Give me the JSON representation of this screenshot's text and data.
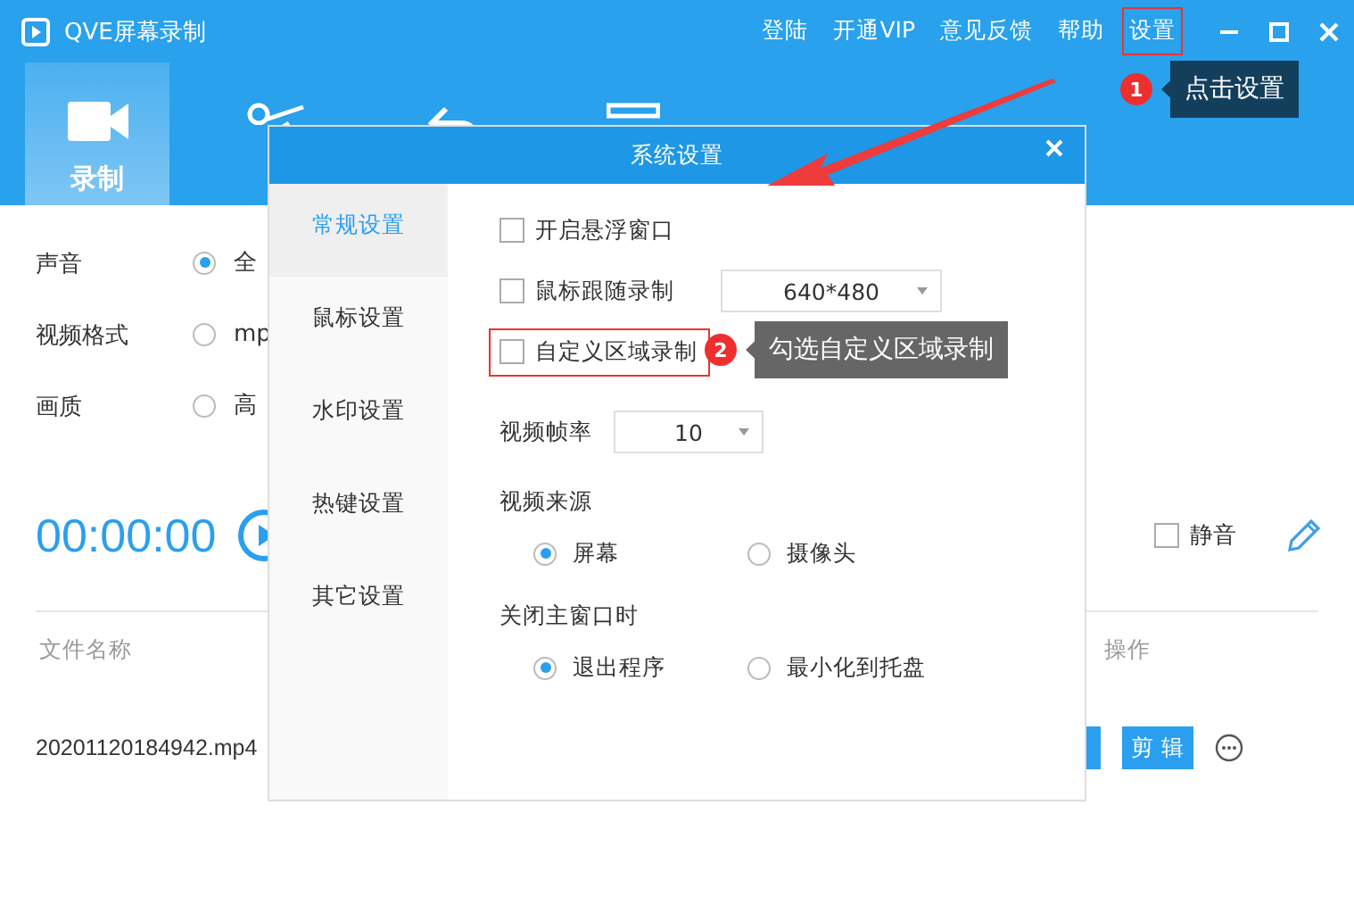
{
  "window": {
    "title": "QVE屏幕录制"
  },
  "top_menu": [
    {
      "label": "登陆",
      "highlighted": false
    },
    {
      "label": "开通VIP",
      "highlighted": false
    },
    {
      "label": "意见反馈",
      "highlighted": false
    },
    {
      "label": "帮助",
      "highlighted": false
    },
    {
      "label": "设置",
      "highlighted": true
    }
  ],
  "tabs": [
    {
      "label": "录制",
      "selected": true
    },
    {
      "selected": false
    },
    {
      "selected": false
    },
    {
      "selected": false
    }
  ],
  "options": [
    {
      "label": "声音",
      "choice": "全",
      "selected": true
    },
    {
      "label": "视频格式",
      "choice": "mp",
      "selected": false
    },
    {
      "label": "画质",
      "choice": "高",
      "selected": false
    }
  ],
  "timer": "00:00:00",
  "audio": {
    "mute": {
      "label": "静音",
      "checked": false
    }
  },
  "file_table": {
    "columns": [
      "文件名称",
      "操作"
    ],
    "rows": [
      {
        "name": "20201120184942.mp4",
        "action": "剪 辑"
      }
    ]
  },
  "dialog": {
    "title": "系统设置",
    "nav": [
      {
        "label": "常规设置",
        "selected": true
      },
      {
        "label": "鼠标设置",
        "selected": false
      },
      {
        "label": "水印设置",
        "selected": false
      },
      {
        "label": "热键设置",
        "selected": false
      },
      {
        "label": "其它设置",
        "selected": false
      }
    ],
    "checkboxes": [
      {
        "label": "开启悬浮窗口",
        "checked": false,
        "highlighted": false
      },
      {
        "label": "鼠标跟随录制",
        "checked": false,
        "highlighted": false,
        "dropdown": "640*480"
      },
      {
        "label": "自定义区域录制",
        "checked": false,
        "highlighted": true
      }
    ],
    "frame_rate": {
      "label": "视频帧率",
      "value": "10"
    },
    "groups": [
      {
        "title": "视频来源",
        "options": [
          {
            "label": "屏幕",
            "selected": true
          },
          {
            "label": "摄像头",
            "selected": false
          }
        ]
      },
      {
        "title": "关闭主窗口时",
        "options": [
          {
            "label": "退出程序",
            "selected": true
          },
          {
            "label": "最小化到托盘",
            "selected": false
          }
        ]
      }
    ]
  },
  "annotations": [
    {
      "number": "1",
      "text": "点击设置",
      "color": "#143f5c"
    },
    {
      "number": "2",
      "text": "勾选自定义区域录制",
      "color": "#666666"
    }
  ]
}
